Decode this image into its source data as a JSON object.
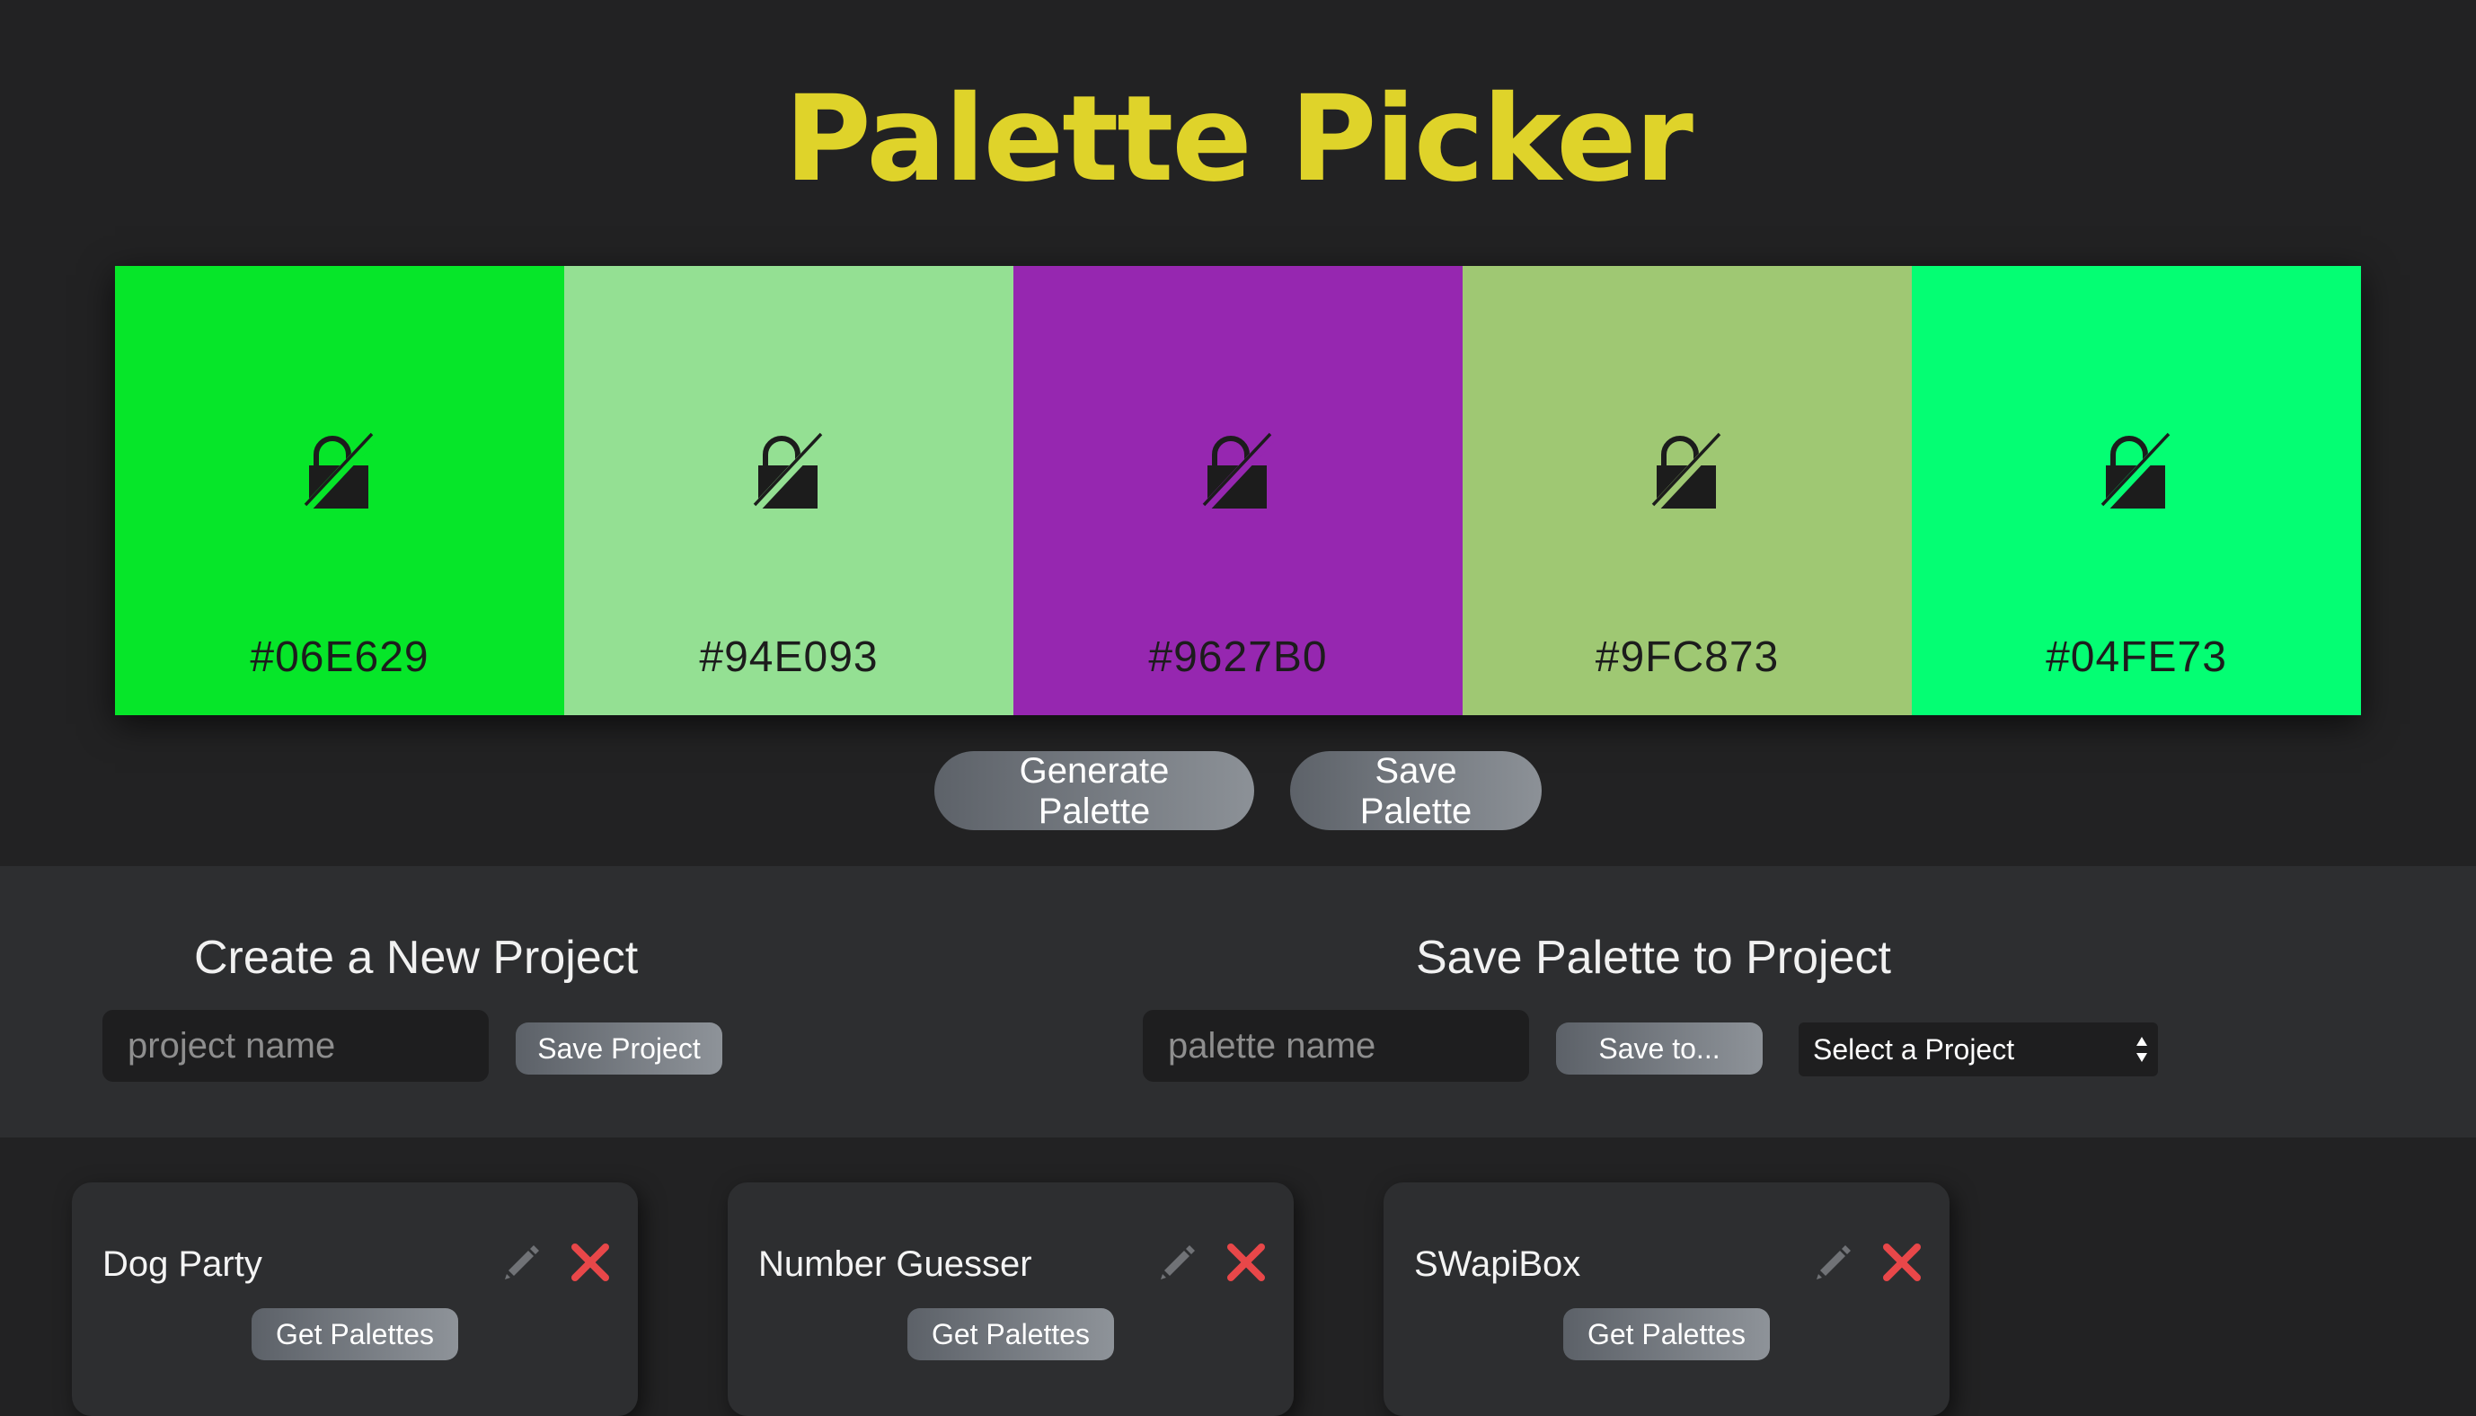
{
  "header": {
    "title": "Palette Picker",
    "title_color": "#DFD32A"
  },
  "palette": {
    "swatches": [
      {
        "hex": "#06E629",
        "locked": false,
        "lock_icon": "unlocked-padlock-icon"
      },
      {
        "hex": "#94E093",
        "locked": false,
        "lock_icon": "unlocked-padlock-icon"
      },
      {
        "hex": "#9627B0",
        "locked": false,
        "lock_icon": "unlocked-padlock-icon"
      },
      {
        "hex": "#9FC873",
        "locked": false,
        "lock_icon": "unlocked-padlock-icon"
      },
      {
        "hex": "#04FE73",
        "locked": false,
        "lock_icon": "unlocked-padlock-icon"
      }
    ]
  },
  "actions": {
    "generate_label": "Generate Palette",
    "save_label": "Save Palette"
  },
  "create_project": {
    "heading": "Create a New Project",
    "input_placeholder": "project name",
    "input_value": "",
    "button_label": "Save Project"
  },
  "save_palette": {
    "heading": "Save Palette to Project",
    "input_placeholder": "palette name",
    "input_value": "",
    "button_label": "Save to...",
    "select_value": "Select a Project"
  },
  "projects": [
    {
      "name": "Dog Party",
      "get_label": "Get Palettes",
      "edit_icon": "pencil-icon",
      "delete_icon": "close-icon"
    },
    {
      "name": "Number Guesser",
      "get_label": "Get Palettes",
      "edit_icon": "pencil-icon",
      "delete_icon": "close-icon"
    },
    {
      "name": "SWapiBox",
      "get_label": "Get Palettes",
      "edit_icon": "pencil-icon",
      "delete_icon": "close-icon"
    }
  ],
  "colors": {
    "page_background": "#222223",
    "band_background": "#2D2E30",
    "delete_red": "#E84749",
    "edit_gray": "#707276"
  }
}
